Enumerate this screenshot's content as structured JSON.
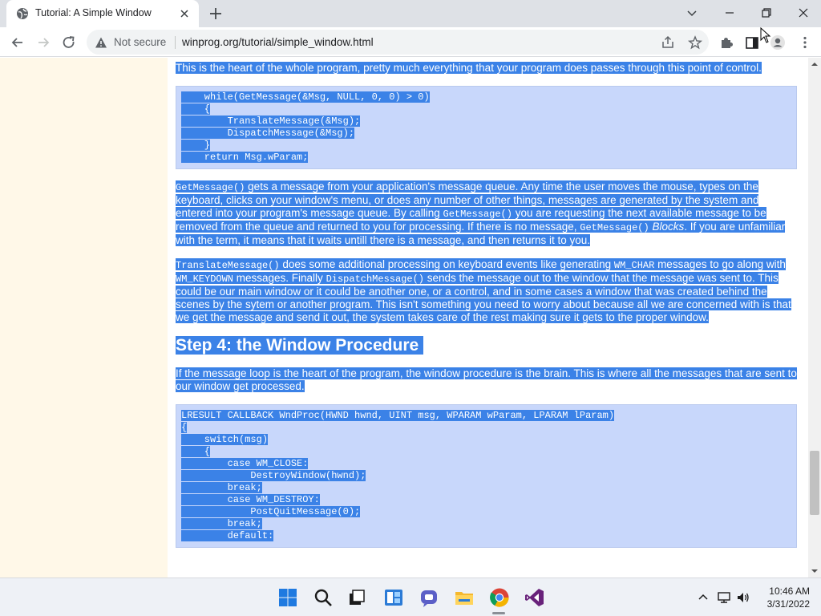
{
  "browser": {
    "tab_title": "Tutorial: A Simple Window",
    "not_secure_label": "Not secure",
    "url": "winprog.org/tutorial/simple_window.html"
  },
  "page": {
    "intro": "This is the heart of the whole program, pretty much everything that your program does passes through this point of control.",
    "code1": [
      "    while(GetMessage(&Msg, NULL, 0, 0) > 0)",
      "    {",
      "        TranslateMessage(&Msg);",
      "        DispatchMessage(&Msg);",
      "    }",
      "    return Msg.wParam;"
    ],
    "para_getmessage": {
      "fn1": "GetMessage()",
      "t1": " gets a message from your application's message queue. Any time the user moves the mouse, types on the keyboard, clicks on your window's menu, or does any number of other things, messages are generated by the system and entered into your program's message queue. By calling ",
      "fn2": "GetMessage()",
      "t2": " you are requesting the next available message to be removed from the queue and returned to you for processing. If there is no message, ",
      "fn3": "GetMessage()",
      "t3": " ",
      "em": "Blocks",
      "t4": ". If you are unfamiliar with the term, it means that it waits untill there is a message, and then returns it to you."
    },
    "para_translate": {
      "fn1": "TranslateMessage()",
      "t1": " does some additional processing on keyboard events like generating ",
      "c1": "WM_CHAR",
      "t2": " messages to go along with ",
      "c2": "WM_KEYDOWN",
      "t3": " messages. Finally ",
      "fn2": "DispatchMessage()",
      "t4": " sends the message out to the window that the message was sent to. This could be our main window or it could be another one, or a control, and in some cases a window that was created behind the scenes by the sytem or another program. This isn't something you need to worry about because all we are concerned with is that we get the message and send it out, the system takes care of the rest making sure it gets to the proper window."
    },
    "step4_heading": "Step 4: the Window Procedure",
    "step4_intro": "If the message loop is the heart of the program, the window procedure is the brain. This is where all the messages that are sent to our window get processed.",
    "code2": [
      "LRESULT CALLBACK WndProc(HWND hwnd, UINT msg, WPARAM wParam, LPARAM lParam)",
      "{",
      "    switch(msg)",
      "    {",
      "        case WM_CLOSE:",
      "            DestroyWindow(hwnd);",
      "        break;",
      "        case WM_DESTROY:",
      "            PostQuitMessage(0);",
      "        break;",
      "        default:"
    ]
  },
  "taskbar": {
    "time": "10:46 AM",
    "date": "3/31/2022",
    "apps": [
      "start-icon",
      "search-icon",
      "task-view-icon",
      "widgets-icon",
      "teams-chat-icon",
      "file-explorer-icon",
      "chrome-icon",
      "visual-studio-icon"
    ]
  },
  "colors": {
    "selection": "#3b82e7",
    "code_background": "#c8d7fb",
    "sidebar_background": "#fff8e8"
  }
}
